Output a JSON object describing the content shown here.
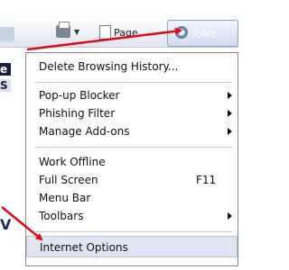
{
  "toolbar": {
    "page_label": "Page",
    "tools_label": "Tools"
  },
  "menu": {
    "delete_history": "Delete Browsing History...",
    "popup_blocker": "Pop-up Blocker",
    "phishing_filter": "Phishing Filter",
    "manage_addons": "Manage Add-ons",
    "work_offline": "Work Offline",
    "full_screen": "Full Screen",
    "full_screen_shortcut": "F11",
    "menu_bar": "Menu Bar",
    "toolbars": "Toolbars",
    "internet_options": "Internet Options"
  },
  "background_fragments": {
    "frag1": "e",
    "frag2": "S",
    "frag3": "V"
  },
  "colors": {
    "annotation_red": "#e30613",
    "highlight": "#dfe6f1"
  }
}
